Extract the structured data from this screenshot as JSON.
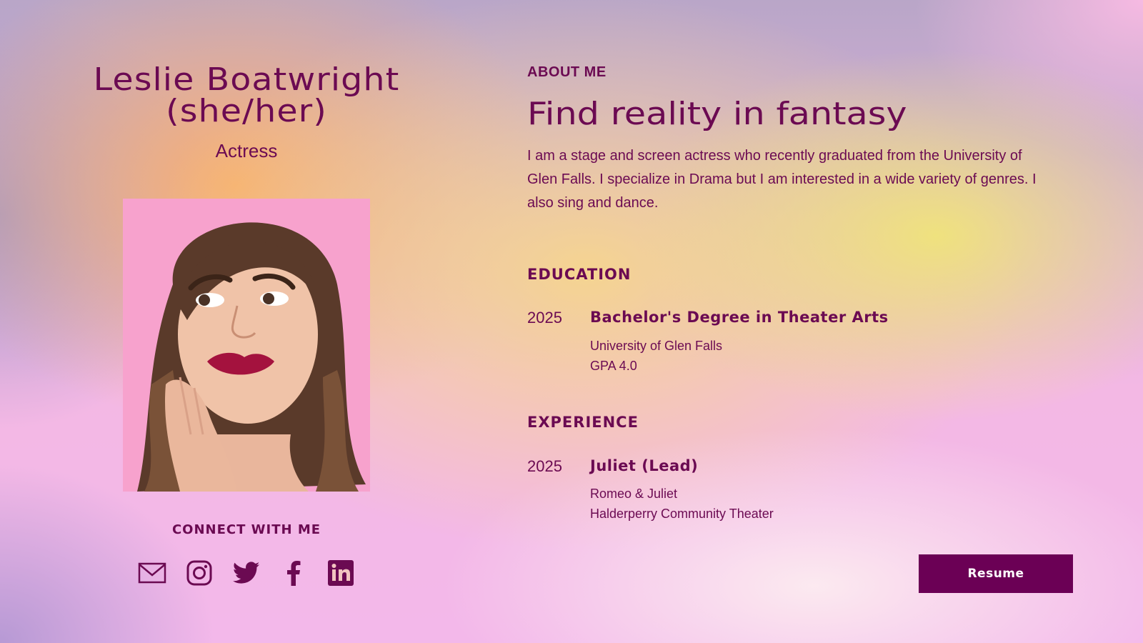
{
  "profile": {
    "name_line1": "Leslie Boatwright",
    "name_line2": "(she/her)",
    "role": "Actress"
  },
  "connect": {
    "heading": "CONNECT WITH ME",
    "links": [
      {
        "icon": "mail-icon",
        "label": "Email"
      },
      {
        "icon": "instagram-icon",
        "label": "Instagram"
      },
      {
        "icon": "twitter-icon",
        "label": "Twitter"
      },
      {
        "icon": "facebook-icon",
        "label": "Facebook"
      },
      {
        "icon": "linkedin-icon",
        "label": "LinkedIn"
      }
    ]
  },
  "about": {
    "eyebrow": "ABOUT ME",
    "headline": "Find reality in fantasy",
    "bio": "I am a stage and screen actress who recently graduated from the University of Glen Falls. I specialize in Drama but I am interested in a wide variety of genres. I also sing and dance."
  },
  "education": {
    "heading": "EDUCATION",
    "entries": [
      {
        "year": "2025",
        "title": "Bachelor's Degree in Theater Arts",
        "line1": "University of Glen Falls",
        "line2": "GPA 4.0"
      }
    ]
  },
  "experience": {
    "heading": "EXPERIENCE",
    "entries": [
      {
        "year": "2025",
        "title": "Juliet (Lead)",
        "line1": "Romeo & Juliet",
        "line2": "Halderperry Community Theater"
      }
    ]
  },
  "resume_button": "Resume",
  "colors": {
    "accent": "#6b0a52",
    "button_bg": "#6b0055",
    "photo_bg": "#f9a3cf"
  }
}
